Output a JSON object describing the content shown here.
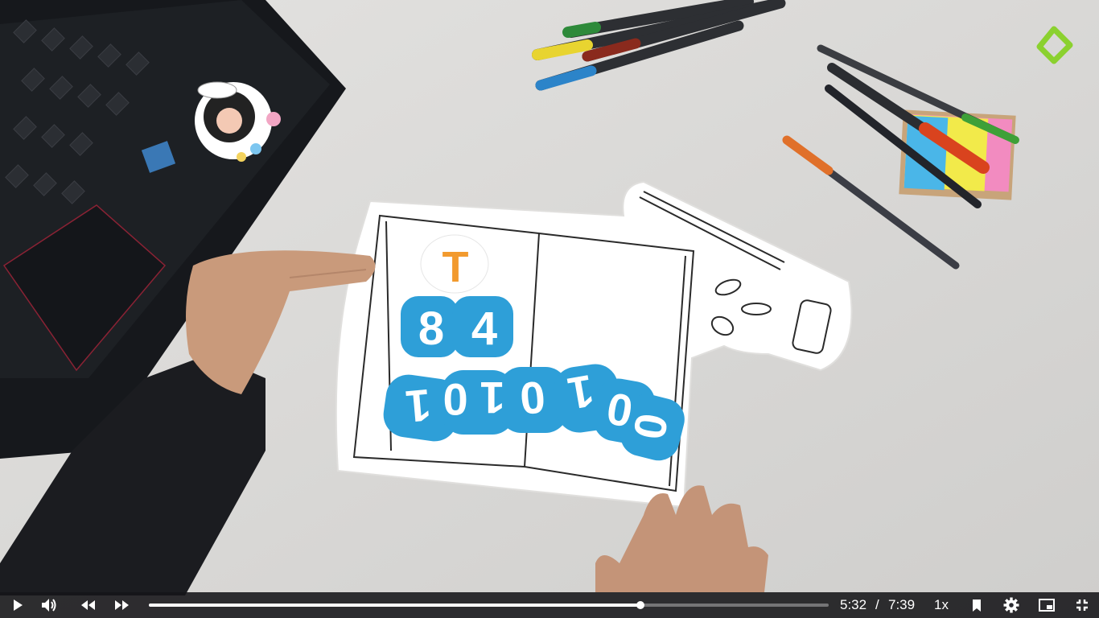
{
  "video": {
    "current_time": "5:32",
    "separator": "/",
    "duration": "7:39",
    "progress_fraction": 0.723,
    "speed_label": "1x"
  },
  "scene": {
    "card_top_letter": "T",
    "card_numbers": [
      "8",
      "4"
    ],
    "card_binary": [
      "1",
      "0",
      "1",
      "0",
      "1",
      "0",
      "0"
    ]
  },
  "colors": {
    "accent_blue": "#2e9fd8",
    "accent_orange": "#f29a2e",
    "logo_green": "#8bd12f",
    "controls_bg": "#141418"
  },
  "icons": {
    "play": "play-icon",
    "volume": "volume-icon",
    "rewind": "rewind-icon",
    "forward": "fast-forward-icon",
    "bookmark": "bookmark-icon",
    "settings": "gear-icon",
    "pip": "picture-in-picture-icon",
    "fullscreen_exit": "exit-fullscreen-icon"
  }
}
